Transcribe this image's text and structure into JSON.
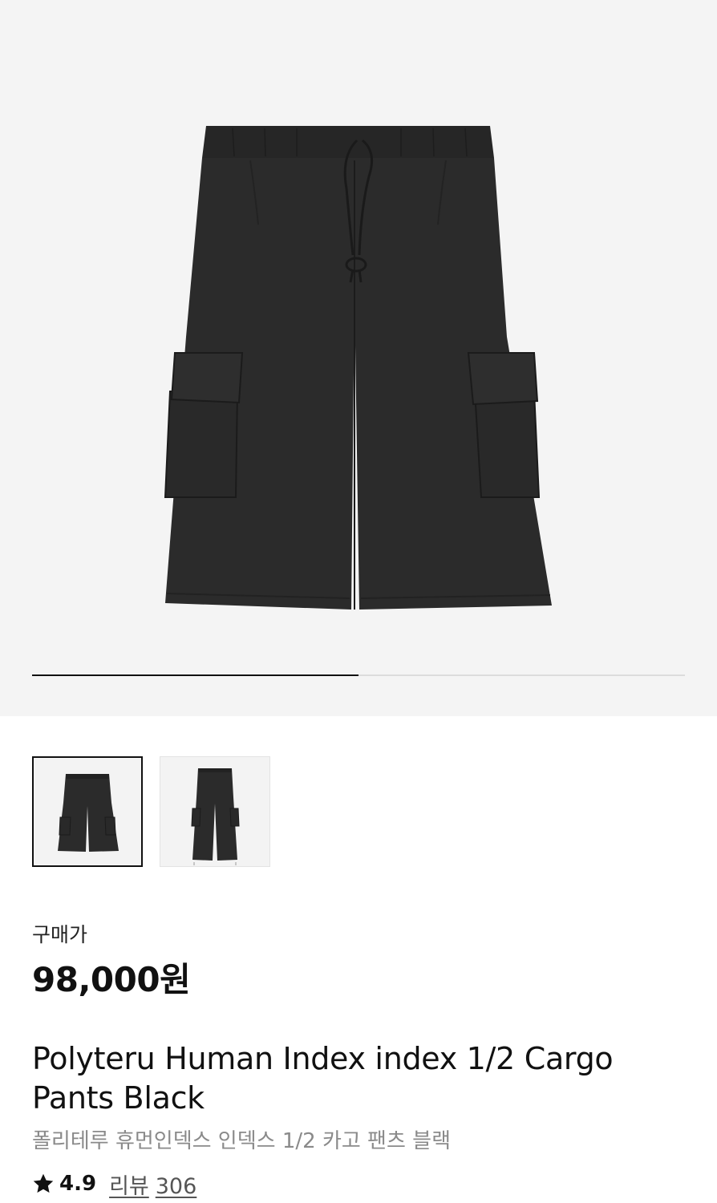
{
  "gallery": {
    "main_image_icon": "cargo-shorts-photo",
    "progress_fraction": 0.5,
    "thumbnails": [
      {
        "icon": "cargo-shorts-thumbnail",
        "selected": true
      },
      {
        "icon": "cargo-pants-thumbnail",
        "selected": false
      }
    ]
  },
  "price": {
    "label": "구매가",
    "value": "98,000원"
  },
  "product": {
    "name": "Polyteru Human Index index 1/2 Cargo Pants Black",
    "name_ko": "폴리테루 휴먼인덱스 인덱스 1/2 카고 팬츠 블랙"
  },
  "rating": {
    "icon": "star-icon",
    "value": "4.9",
    "review_label": "리뷰",
    "review_count": "306"
  },
  "colors": {
    "garment": "#2b2b2b",
    "hero_bg": "#f4f4f4",
    "text_primary": "#111111",
    "text_secondary": "#8a8a8a"
  }
}
